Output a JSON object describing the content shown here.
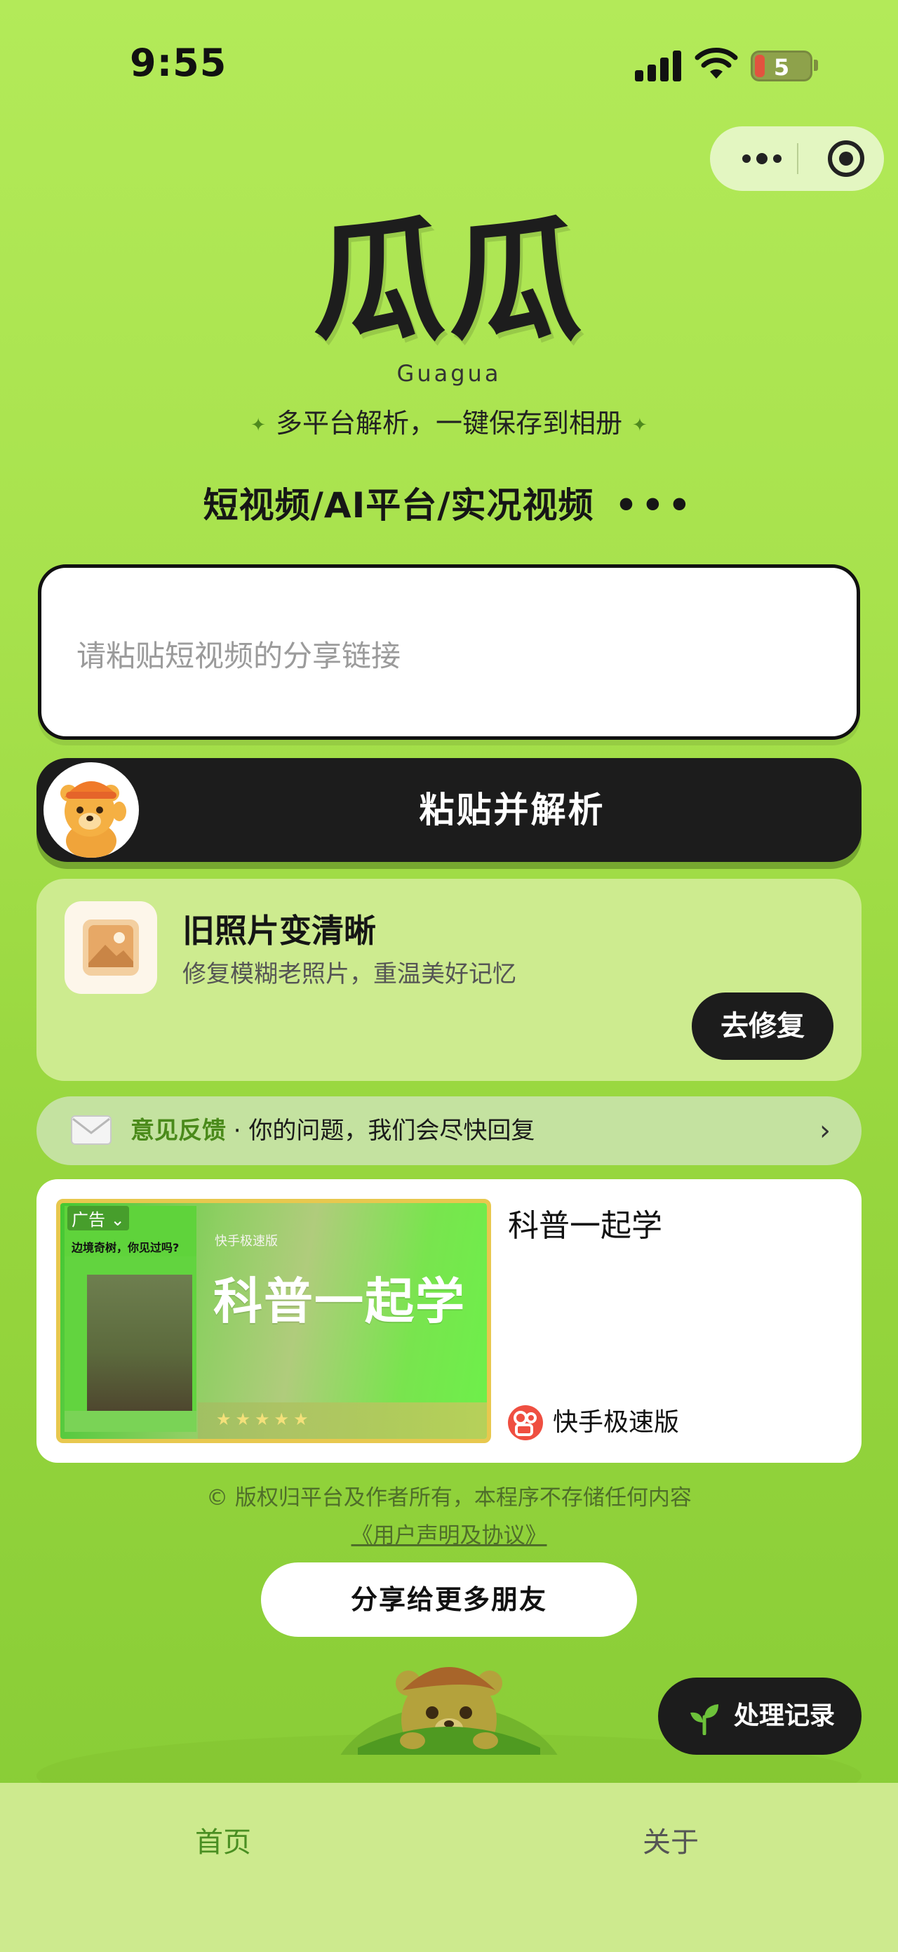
{
  "status_bar": {
    "time": "9:55",
    "battery": "5"
  },
  "capsule": {
    "more_icon": "more-dots-icon",
    "close_icon": "target-circle-icon"
  },
  "app": {
    "name": "瓜瓜",
    "name_en": "Guagua",
    "tagline": "多平台解析，一键保存到相册",
    "platforms": "短视频/AI平台/实况视频",
    "platforms_more": "•••"
  },
  "input": {
    "placeholder": "请粘贴短视频的分享链接",
    "value": ""
  },
  "paste_button": {
    "label": "粘贴并解析"
  },
  "restore_card": {
    "title": "旧照片变清晰",
    "description": "修复模糊老照片，重温美好记忆",
    "button": "去修复"
  },
  "feedback": {
    "highlight": "意见反馈",
    "separator": " · ",
    "text": "你的问题，我们会尽快回复",
    "arrow": "›"
  },
  "ad": {
    "tag": "广告 ⌄",
    "poster_title": "边境奇树，你见过吗?",
    "brand_small": "快手极速版",
    "headline": "科普一起学",
    "stars": "★★★★★",
    "title": "科普一起学",
    "app_name": "快手极速版"
  },
  "footer": {
    "copyright": "© 版权归平台及作者所有，本程序不存储任何内容",
    "agreement": "《用户声明及协议》"
  },
  "share_button": {
    "label": "分享给更多朋友"
  },
  "history_button": {
    "label": "处理记录"
  },
  "tabbar": {
    "home": "首页",
    "about": "关于"
  },
  "colors": {
    "accent_green": "#4a8f22",
    "background": "#a8e24d",
    "dark": "#1c1c1c"
  }
}
